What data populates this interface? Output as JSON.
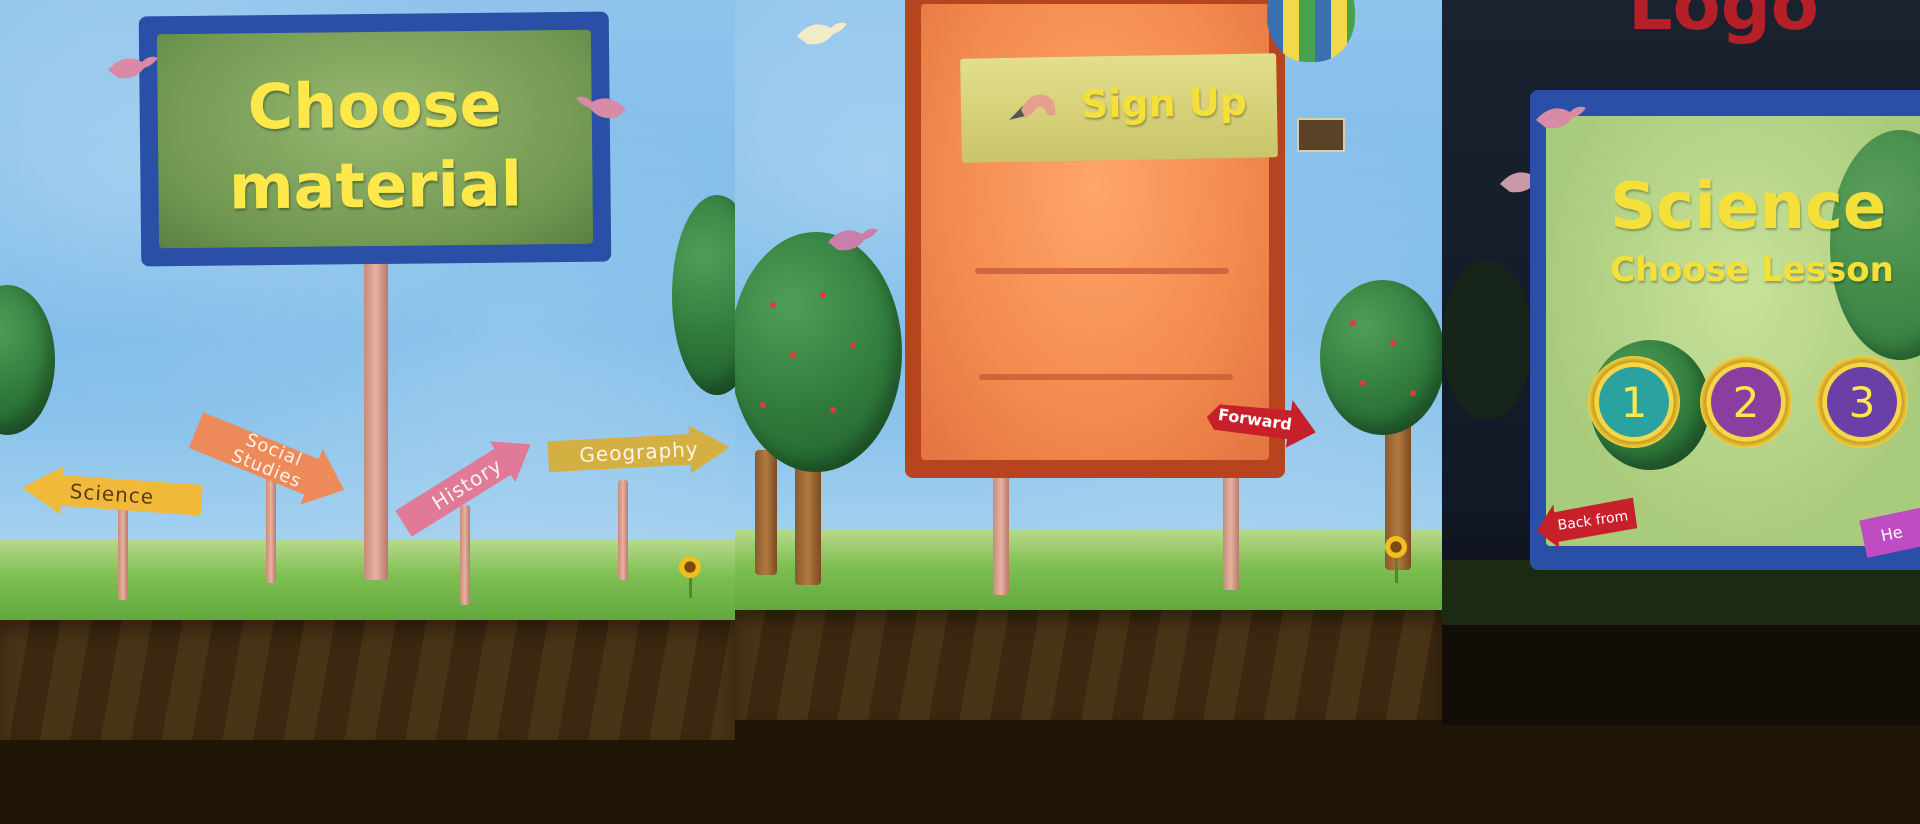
{
  "screen1": {
    "title_line1": "Choose",
    "title_line2": "material",
    "signs": {
      "science": "Science",
      "social_line1": "Social",
      "social_line2": "Studies",
      "history": "History",
      "geography": "Geography"
    }
  },
  "screen2": {
    "header": "Sign Up",
    "forward_button": "Forward"
  },
  "screen3": {
    "logo": "Logo",
    "title": "Science",
    "subtitle": "Choose Lesson",
    "lessons": [
      "1",
      "2",
      "3"
    ],
    "back_button": "Back from",
    "help_button": "He"
  },
  "colors": {
    "title_yellow": "#ffe84a",
    "board_green": "#7da15a",
    "board_frame_blue": "#2a4fa6",
    "signup_orange": "#f58a4a",
    "logo_red": "#b51f28",
    "soil_dark": "#1f1608"
  }
}
